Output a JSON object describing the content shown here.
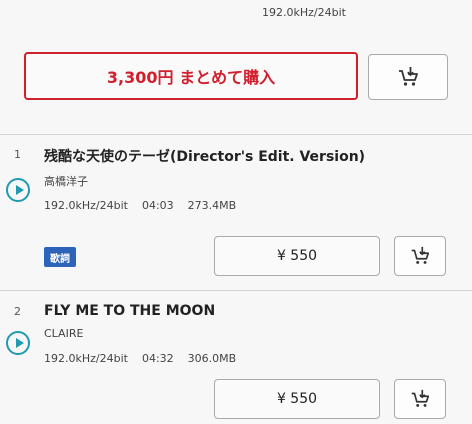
{
  "header": {
    "format": "192.0kHz/24bit"
  },
  "bulk": {
    "buy_label": "3,300円 まとめて購入"
  },
  "tracks": [
    {
      "number": "1",
      "title": "残酷な天使のテーゼ(Director's Edit. Version)",
      "artist": "高橋洋子",
      "format": "192.0kHz/24bit",
      "duration": "04:03",
      "size": "273.4MB",
      "lyrics_badge": "歌詞",
      "price": "¥ 550"
    },
    {
      "number": "2",
      "title": "FLY ME TO THE MOON",
      "artist": "CLAIRE",
      "format": "192.0kHz/24bit",
      "duration": "04:32",
      "size": "306.0MB",
      "price": "¥ 550"
    }
  ],
  "colors": {
    "accent_red": "#d0202e",
    "play_teal": "#1f9ab0",
    "lyrics_blue": "#2d63b8"
  },
  "icons": {
    "cart": "cart-download-icon",
    "play": "play-icon"
  }
}
